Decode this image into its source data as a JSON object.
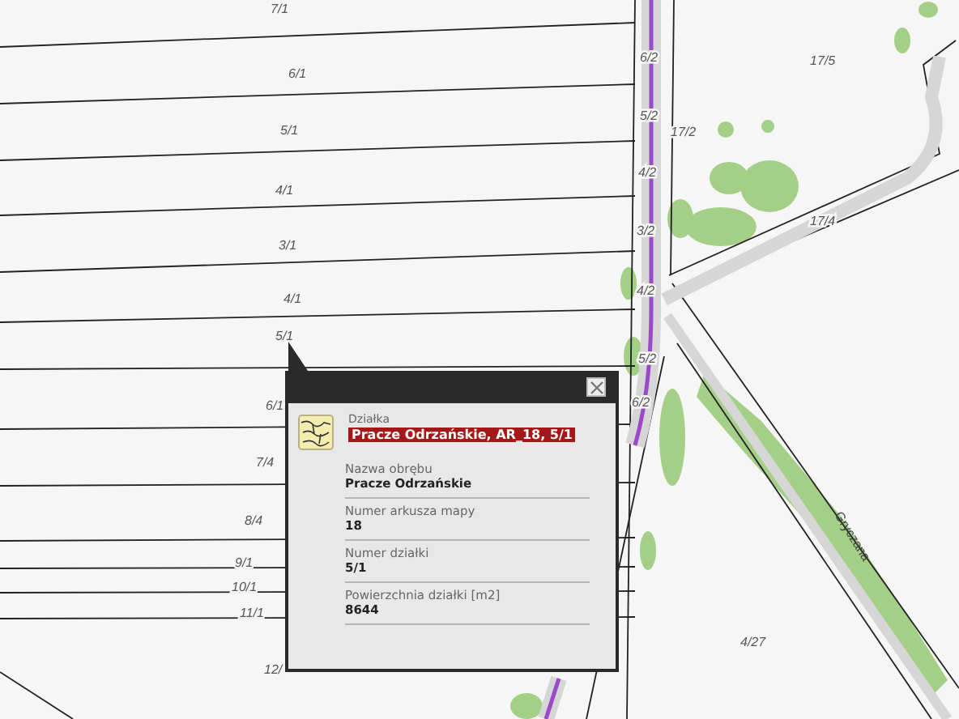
{
  "map": {
    "parcel_labels": [
      "7/1",
      "6/1",
      "5/1",
      "4/1",
      "3/1",
      "4/1",
      "5/1",
      "6/1",
      "7/4",
      "8/4",
      "9/1",
      "10/1",
      "11/1",
      "12/",
      "6/2",
      "5/2",
      "4/2",
      "3/2",
      "4/2",
      "5/2",
      "6/2",
      "17/2",
      "17/5",
      "17/4",
      "4/27"
    ],
    "street_label": "Gryczana"
  },
  "popup": {
    "layer": "Działka",
    "title": "Pracze Odrzańskie, AR_18, 5/1",
    "fields": [
      {
        "label": "Nazwa obrębu",
        "value": "Pracze Odrzańskie"
      },
      {
        "label": "Numer arkusza mapy",
        "value": "18"
      },
      {
        "label": "Numer działki",
        "value": "5/1"
      },
      {
        "label": "Powierzchnia działki [m2]",
        "value": "8644"
      }
    ]
  }
}
